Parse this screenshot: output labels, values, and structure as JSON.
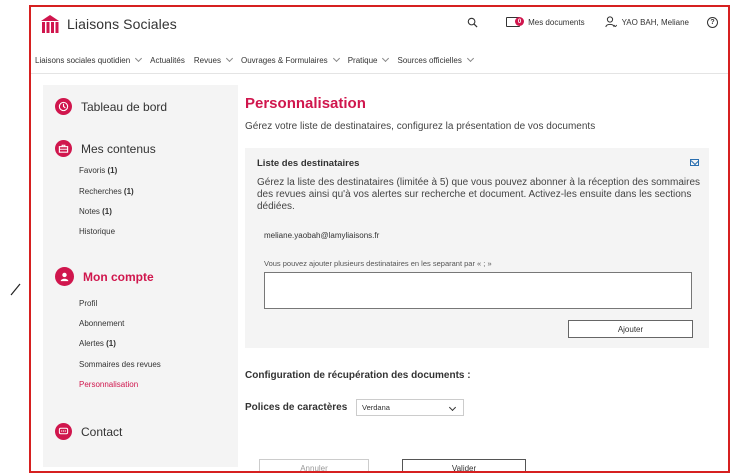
{
  "header": {
    "logo_text": "Liaisons Sociales",
    "documents_label": "Mes documents",
    "documents_count": "0",
    "user_name": "YAO BAH, Meliane",
    "help_glyph": "?"
  },
  "nav": {
    "items": [
      {
        "label": "Liaisons sociales quotidien",
        "dropdown": true
      },
      {
        "label": "Actualités",
        "dropdown": false
      },
      {
        "label": "Revues",
        "dropdown": true
      },
      {
        "label": "Ouvrages & Formulaires",
        "dropdown": true
      },
      {
        "label": "Pratique",
        "dropdown": true
      },
      {
        "label": "Sources officielles",
        "dropdown": true
      }
    ]
  },
  "sidebar": {
    "dashboard": "Tableau de bord",
    "contents": "Mes contenus",
    "contents_items": [
      {
        "label": "Favoris",
        "count": "(1)"
      },
      {
        "label": "Recherches",
        "count": "(1)"
      },
      {
        "label": "Notes",
        "count": "(1)"
      },
      {
        "label": "Historique",
        "count": ""
      }
    ],
    "account": "Mon compte",
    "account_items": [
      {
        "label": "Profil",
        "count": ""
      },
      {
        "label": "Abonnement",
        "count": ""
      },
      {
        "label": "Alertes",
        "count": "(1)"
      },
      {
        "label": "Sommaires des revues",
        "count": ""
      },
      {
        "label": "Personnalisation",
        "count": ""
      }
    ],
    "contact": "Contact"
  },
  "main": {
    "title": "Personnalisation",
    "subtitle": "Gérez votre liste de destinataires, configurez la présentation de vos documents",
    "recipients": {
      "title": "Liste des destinataires",
      "description": "Gérez la liste des destinataires (limitée à 5) que vous pouvez abonner à la réception des sommaires des revues ainsi qu'à vos alertes sur recherche et document. Activez-les ensuite dans les sections dédiées.",
      "email": "meliane.yaobah@lamyliaisons.fr",
      "hint": "Vous pouvez ajouter plusieurs destinataires en les separant par « ; »",
      "textarea_value": "",
      "add_button": "Ajouter"
    },
    "config_title": "Configuration de récupération des documents :",
    "font_label": "Polices de caractères",
    "font_value": "Verdana",
    "cancel_button": "Annuler",
    "validate_button": "Valider"
  },
  "colors": {
    "accent": "#d0164d",
    "frame": "#d62020",
    "panel_bg": "#f4f4f4"
  }
}
